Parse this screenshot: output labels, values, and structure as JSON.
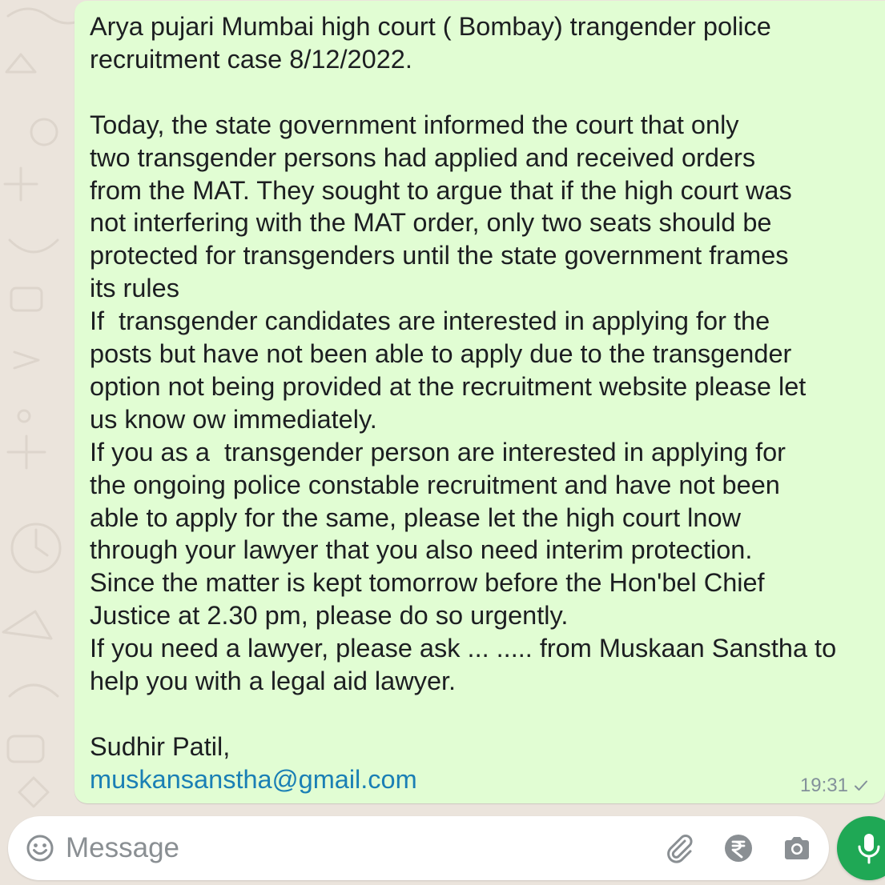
{
  "message": {
    "lines": [
      "Arya pujari Mumbai high court ( Bombay) trangender police",
      "recruitment case 8/12/2022.",
      "",
      "Today, the state government informed the court that only",
      "two transgender persons had applied and received orders",
      "from the MAT. They sought to argue that if the high court was",
      "not interfering with the MAT order, only two seats should be",
      "protected for transgenders until the state government frames",
      "its rules",
      "If  transgender candidates are interested in applying for the",
      "posts but have not been able to apply due to the transgender",
      "option not being provided at the recruitment website please let",
      "us know ow immediately.",
      "If you as a  transgender person are interested in applying for",
      "the ongoing police constable recruitment and have not been",
      "able to apply for the same, please let the high court lnow",
      "through your lawyer that you also need interim protection.",
      "Since the matter is kept tomorrow before the Hon'bel Chief",
      "Justice at 2.30 pm, please do so urgently.",
      "If you need a lawyer, please ask ... ..... from Muskaan Sanstha to",
      "help you with a legal aid lawyer.",
      "",
      "Sudhir Patil,"
    ],
    "email": "muskansanstha@gmail.com",
    "time": "19:31",
    "status_icon": "single-check-icon"
  },
  "composer": {
    "placeholder": "Message",
    "icons": [
      "emoji-icon",
      "attach-icon",
      "rupee-payment-icon",
      "camera-icon"
    ],
    "send_icon": "mic-icon"
  },
  "colors": {
    "bubble": "#e1fdd3",
    "link": "#1a7fb5",
    "mic_button": "#1fa855",
    "background": "#ebe4dc"
  }
}
